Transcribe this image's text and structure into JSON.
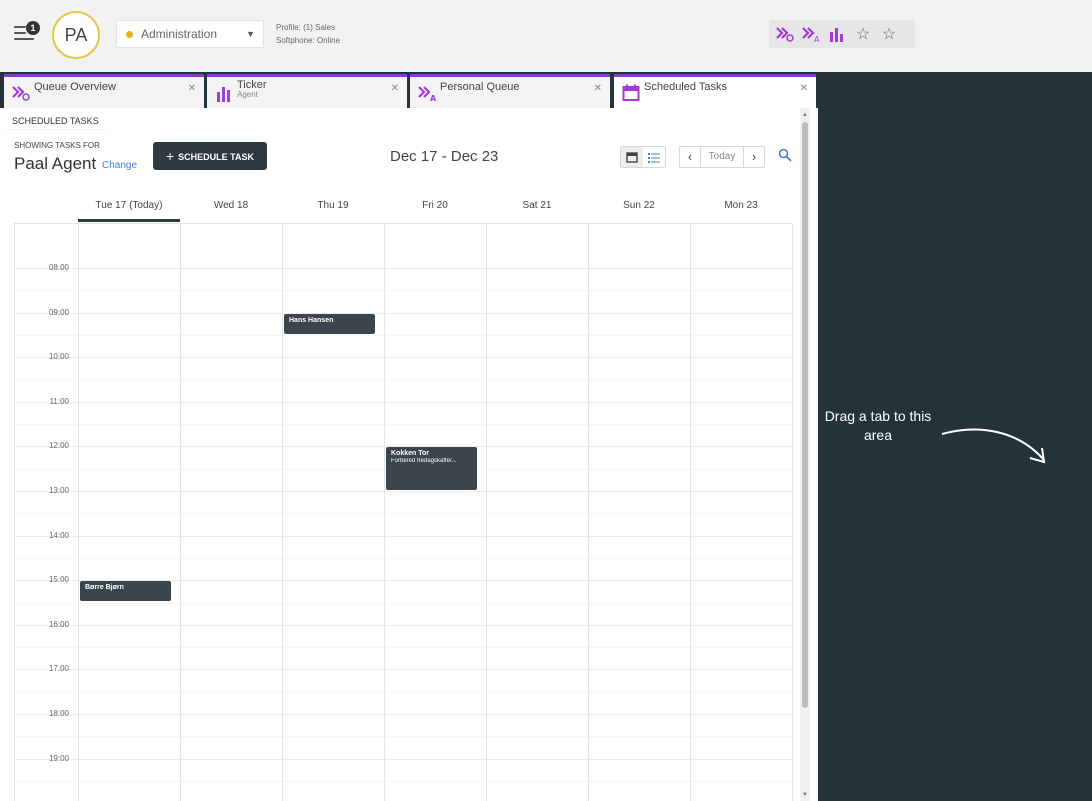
{
  "header": {
    "notification_count": "1",
    "avatar_initials": "PA",
    "status": {
      "label": "Administration",
      "color": "#e7b416"
    },
    "profile_line": "Profile: (1) Sales",
    "softphone_line": "Softphone: Online",
    "accent_color": "#a33bd9"
  },
  "tabs": [
    {
      "title": "Queue Overview",
      "subtitle": "",
      "icon": "queue-overview-icon"
    },
    {
      "title": "Ticker",
      "subtitle": "Agent",
      "icon": "bar-chart-icon"
    },
    {
      "title": "Personal Queue",
      "subtitle": "",
      "icon": "personal-queue-icon"
    },
    {
      "title": "Scheduled Tasks",
      "subtitle": "",
      "icon": "calendar-icon",
      "active": true
    }
  ],
  "dropzone": {
    "text": "Drag a tab to this area"
  },
  "scheduler": {
    "section_label": "SCHEDULED TASKS",
    "showing_label": "SHOWING TASKS FOR",
    "agent_name": "Paal Agent",
    "change_label": "Change",
    "schedule_button": "SCHEDULE TASK",
    "date_range": "Dec 17 - Dec 23",
    "today_label": "Today",
    "days": [
      "Tue 17 (Today)",
      "Wed 18",
      "Thu 19",
      "Fri 20",
      "Sat 21",
      "Sun 22",
      "Mon 23"
    ],
    "hours": [
      "08:00",
      "09:00",
      "10:00",
      "11:00",
      "12:00",
      "13:00",
      "14:00",
      "15:00",
      "16:00",
      "17:00",
      "18:00",
      "19:00"
    ],
    "events": [
      {
        "title": "Hans Hansen",
        "subtitle": "",
        "day": 2,
        "start": 9.0,
        "end": 9.5
      },
      {
        "title": "Kokken Tor",
        "subtitle": "Forbered fredagskaffe/...",
        "day": 3,
        "start": 12.0,
        "end": 13.0
      },
      {
        "title": "Børre Bjørn",
        "subtitle": "",
        "day": 0,
        "start": 15.0,
        "end": 15.5
      }
    ]
  }
}
